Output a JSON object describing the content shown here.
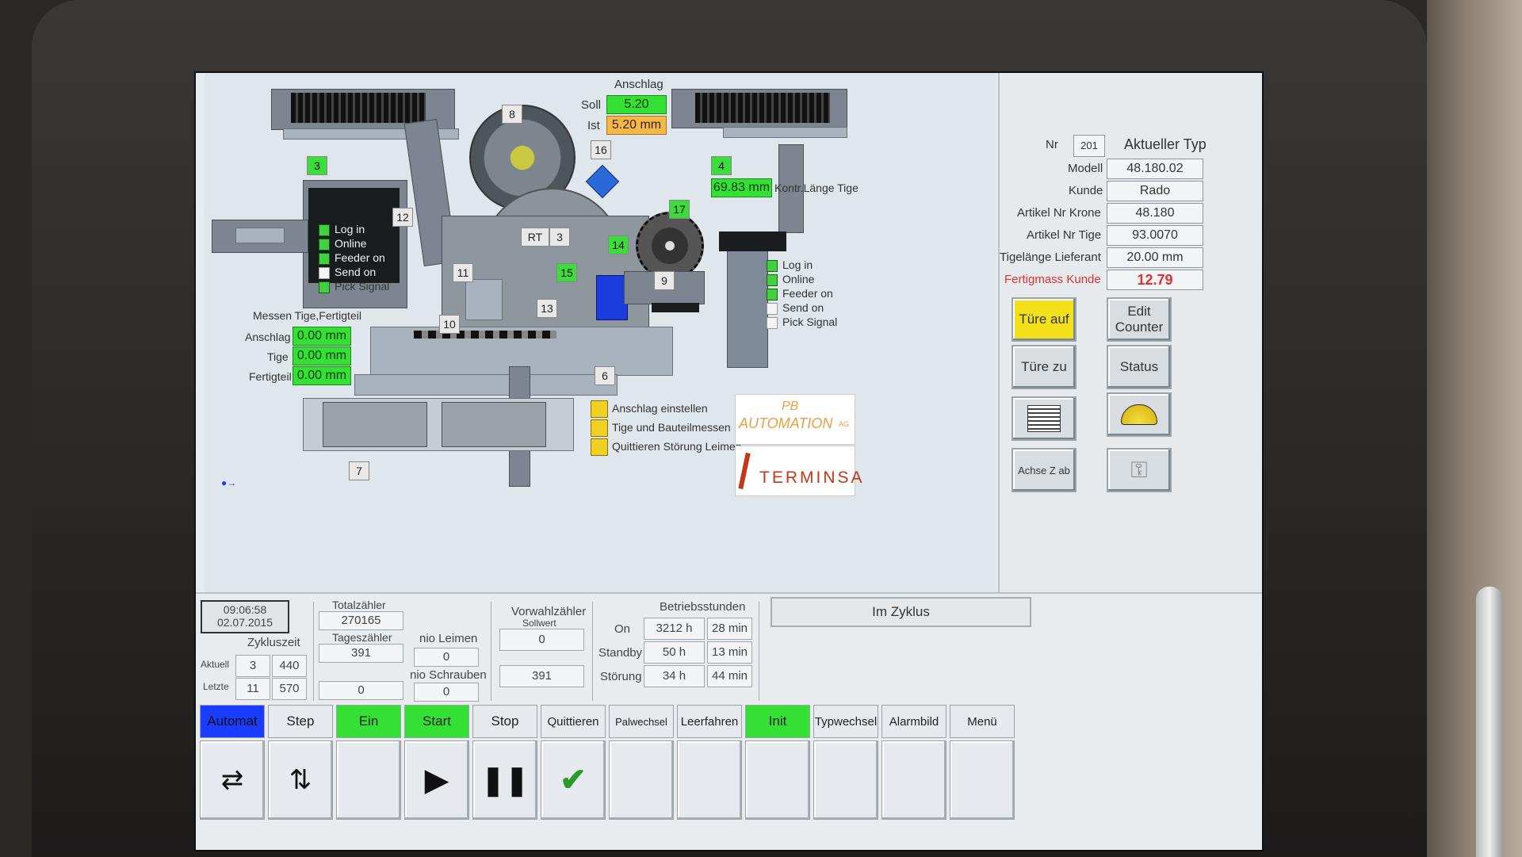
{
  "anschlag": {
    "title": "Anschlag",
    "soll_label": "Soll",
    "soll_value": "5.20",
    "ist_label": "Ist",
    "ist_value": "5.20 mm"
  },
  "station_numbers": [
    "8",
    "3",
    "16",
    "4",
    "12",
    "RT",
    "3",
    "17",
    "14",
    "11",
    "15",
    "9",
    "13",
    "10",
    "6",
    "7"
  ],
  "kontr_value": "69.83 mm",
  "kontr_label": "Kontr.Länge Tige",
  "left_status": [
    "Log  in",
    "Online",
    "Feeder on",
    "Send on",
    "Pick Signal"
  ],
  "right_status": [
    "Log  in",
    "Online",
    "Feeder on",
    "Send on",
    "Pick Signal"
  ],
  "messen": {
    "title": "Messen Tige,Fertigteil",
    "rows": [
      {
        "label": "Anschlag",
        "value": "0.00 mm"
      },
      {
        "label": "Tige",
        "value": "0.00 mm"
      },
      {
        "label": "Fertigteil",
        "value": "0.00 mm"
      }
    ]
  },
  "tasks": [
    "Anschlag einstellen",
    "Tige und Bauteilmessen",
    "Quittieren Störung Leimen"
  ],
  "logos": {
    "pb_line1": "PB",
    "pb_line2": "AUTOMATION",
    "pb_suffix": "AG",
    "terminsa": "TERMINSA"
  },
  "type_info": {
    "nr_label": "Nr",
    "nr_value": "201",
    "aktueller_typ": "Aktueller Typ",
    "rows": [
      {
        "label": "Modell",
        "value": "48.180.02"
      },
      {
        "label": "Kunde",
        "value": "Rado"
      },
      {
        "label": "Artikel Nr Krone",
        "value": "48.180"
      },
      {
        "label": "Artikel Nr Tige",
        "value": "93.0070"
      },
      {
        "label": "Tigelänge Lieferant",
        "value": "20.00 mm"
      },
      {
        "label": "Fertigmass Kunde",
        "value": "12.79"
      }
    ]
  },
  "buttons": {
    "tuere_auf": "Türe auf",
    "edit_counter": "Edit Counter",
    "tuere_zu": "Türe zu",
    "status": "Status",
    "achse_z_ab": "Achse Z ab"
  },
  "clock": {
    "time": "09:06:58",
    "date": "02.07.2015"
  },
  "zykluszeit": {
    "title": "Zykluszeit",
    "aktuell_label": "Aktuell",
    "aktuell": [
      "3",
      "440"
    ],
    "letzte_label": "Letzte",
    "letzte": [
      "11",
      "570"
    ]
  },
  "counters": {
    "totalzaehler_label": "Totalzähler",
    "totalzaehler": "270165",
    "tageszaehler_label": "Tageszähler",
    "tageszaehler": "391",
    "extra": "0",
    "nio_leimen_label": "nio Leimen",
    "nio_leimen": "0",
    "nio_schrauben_label": "nio Schrauben",
    "nio_schrauben": "0",
    "vorwahl_label": "Vorwahlzähler",
    "sollwert_label": "Sollwert",
    "vorwahl_soll": "0",
    "vorwahl_ist": "391"
  },
  "betrieb": {
    "title": "Betriebsstunden",
    "rows": [
      {
        "label": "On",
        "h": "3212 h",
        "min": "28 min"
      },
      {
        "label": "Standby",
        "h": "50 h",
        "min": "13 min"
      },
      {
        "label": "Störung",
        "h": "34 h",
        "min": "44 min"
      }
    ]
  },
  "status_text": "Im Zyklus",
  "tabs": [
    "Automat",
    "Step",
    "Ein",
    "Start",
    "Stop",
    "Quittieren",
    "Palwechsel",
    "Leerfahren",
    "Init",
    "Typwechsel",
    "Alarmbild",
    "Menü"
  ],
  "colors": {
    "green": "#35e035",
    "orange": "#f4b84a",
    "yellow": "#f2e01a",
    "blue": "#1a3cff",
    "red_label": "#e03030"
  }
}
